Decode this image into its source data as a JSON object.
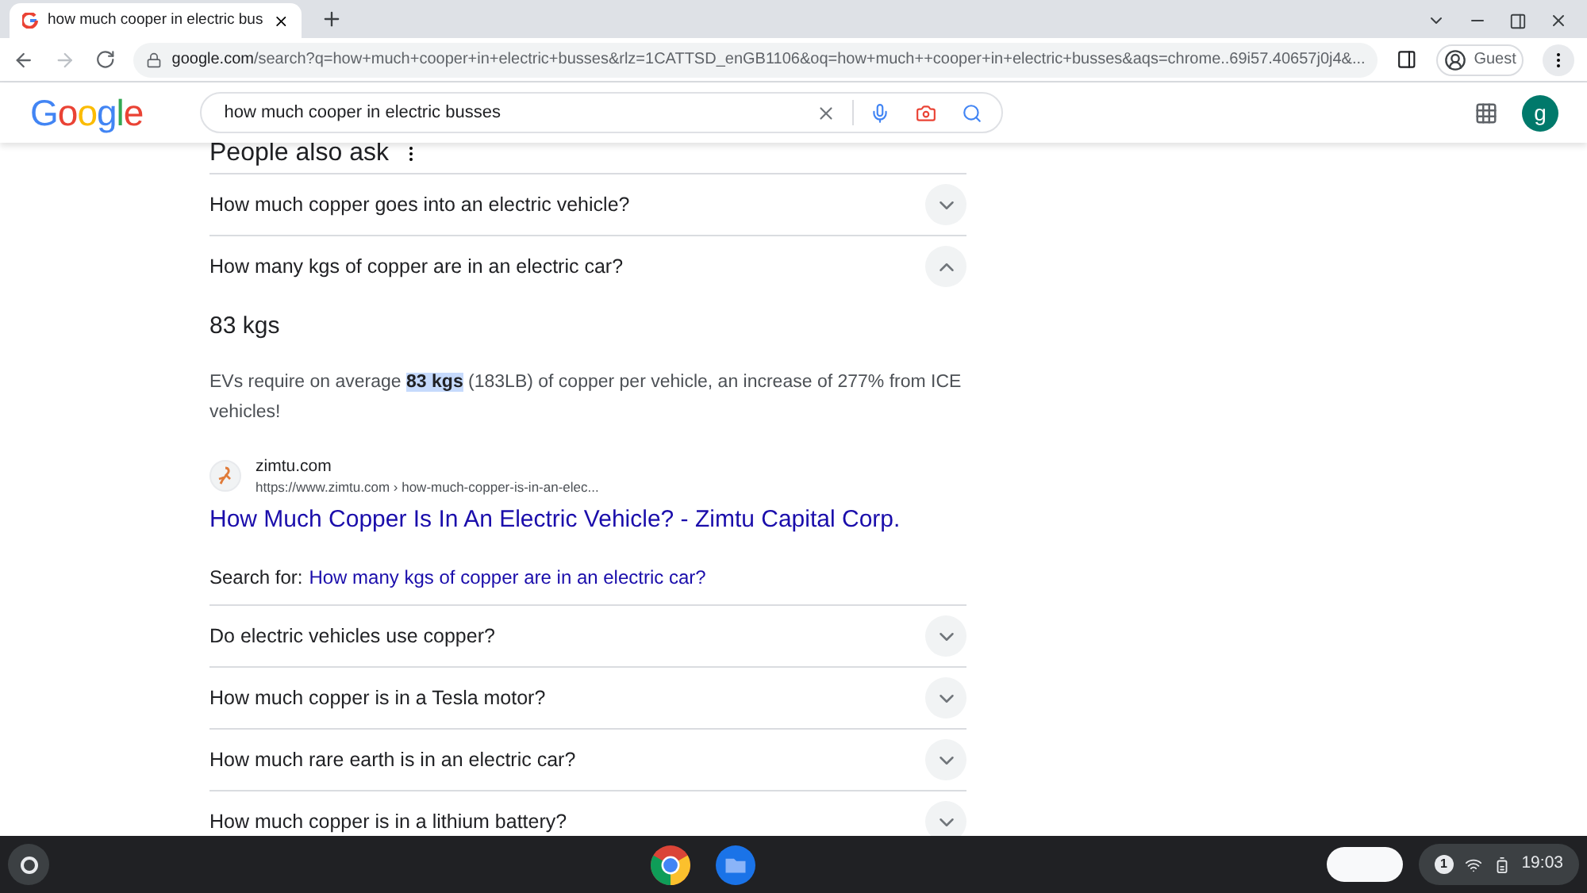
{
  "tab": {
    "title": "how much cooper in electric bus"
  },
  "address_bar": {
    "host": "google.com",
    "path": "/search?q=how+much+cooper+in+electric+busses&rlz=1CATTSD_enGB1106&oq=how+much++cooper+in+electric+busses&aqs=chrome..69i57.40657j0j4&..."
  },
  "profile": {
    "label": "Guest"
  },
  "header": {
    "logo": "Google",
    "query": "how much cooper in electric busses",
    "account_initial": "g"
  },
  "people_also_ask": {
    "title": "People also ask",
    "questions": [
      {
        "text": "How much copper goes into an electric vehicle?",
        "expanded": false
      },
      {
        "text": "How many kgs of copper are in an electric car?",
        "expanded": true,
        "answer": {
          "heading": "83 kgs",
          "before": "EVs require on average ",
          "highlight": "83 kgs",
          "after": " (183LB) of copper per vehicle, an increase of 277% from ICE vehicles!",
          "source_site": "zimtu.com",
          "source_url": "https://www.zimtu.com › how-much-copper-is-in-an-elec...",
          "link_title": "How Much Copper Is In An Electric Vehicle? - Zimtu Capital Corp.",
          "search_for_label": "Search for:",
          "search_for_link": "How many kgs of copper are in an electric car?"
        }
      },
      {
        "text": "Do electric vehicles use copper?",
        "expanded": false
      },
      {
        "text": "How much copper is in a Tesla motor?",
        "expanded": false
      },
      {
        "text": "How much rare earth is in an electric car?",
        "expanded": false
      },
      {
        "text": "How much copper is in a lithium battery?",
        "expanded": false
      }
    ]
  },
  "taskbar": {
    "notification_count": "1",
    "time": "19:03"
  }
}
